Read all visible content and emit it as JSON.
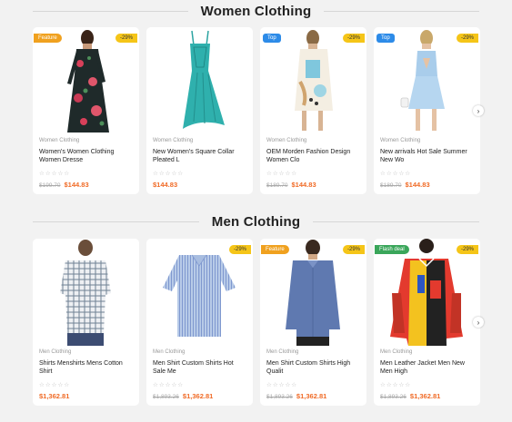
{
  "women_section": {
    "title": "Women Clothing",
    "products": [
      {
        "tag_left": "Feature",
        "tag_left_type": "feature",
        "discount": "-29%",
        "category": "Women Clothing",
        "title": "Women's Women Clothing Women Dresse",
        "old_price": "$199.70",
        "price": "$144.83",
        "image": "floral-maxi-dress"
      },
      {
        "tag_left": "",
        "tag_left_type": "",
        "discount": "",
        "category": "Women Clothing",
        "title": "New Women's Square Collar Pleated L",
        "old_price": "",
        "price": "$144.83",
        "image": "teal-lace-dress"
      },
      {
        "tag_left": "Top",
        "tag_left_type": "top",
        "discount": "-29%",
        "category": "Women Clothing",
        "title": "OEM Morden Fashion Design Women Clo",
        "old_price": "$189.70",
        "price": "$144.83",
        "image": "pattern-shift-dress"
      },
      {
        "tag_left": "Top",
        "tag_left_type": "top",
        "discount": "-29%",
        "category": "Women Clothing",
        "title": "New arrivals Hot Sale Summer New Wo",
        "old_price": "$189.70",
        "price": "$144.83",
        "image": "blue-sundress"
      }
    ]
  },
  "men_section": {
    "title": "Men Clothing",
    "products": [
      {
        "tag_left": "",
        "tag_left_type": "",
        "discount": "",
        "category": "Men Clothing",
        "title": "Shirts Menshirts Mens Cotton Shirt",
        "old_price": "",
        "price": "$1,362.81",
        "image": "plaid-shirt"
      },
      {
        "tag_left": "",
        "tag_left_type": "",
        "discount": "-29%",
        "category": "Men Clothing",
        "title": "Men Shirt Custom Shirts Hot Sale Me",
        "old_price": "$1,893.26",
        "price": "$1,362.81",
        "image": "striped-shirt"
      },
      {
        "tag_left": "Feature",
        "tag_left_type": "feature",
        "discount": "-29%",
        "category": "Men Clothing",
        "title": "Men Shirt Custom Shirts High Qualit",
        "old_price": "$1,893.26",
        "price": "$1,362.81",
        "image": "blue-dress-shirt"
      },
      {
        "tag_left": "Flash deal",
        "tag_left_type": "flash",
        "discount": "-29%",
        "category": "Men Clothing",
        "title": "Men Leather Jacket Men New Men High",
        "old_price": "$1,893.26",
        "price": "$1,362.81",
        "image": "varsity-jacket"
      }
    ]
  },
  "rating_stars": "☆☆☆☆☆",
  "next_arrow": "›",
  "colors": {
    "feature": "#f0a11f",
    "top": "#2d8be8",
    "flash": "#3aa65a",
    "discount": "#f5c518",
    "price": "#f06a25"
  }
}
